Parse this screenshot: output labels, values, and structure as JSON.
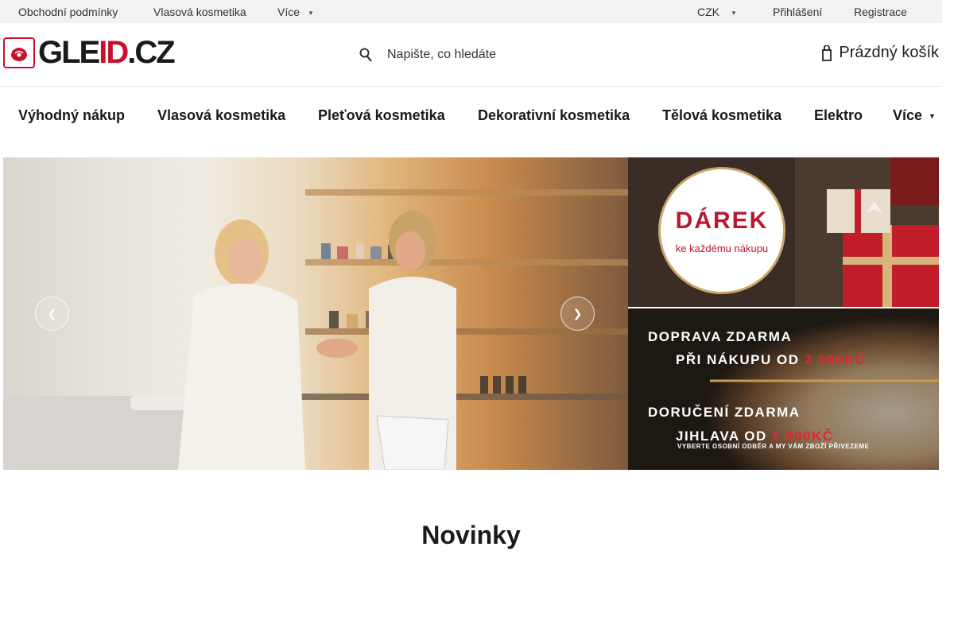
{
  "topbar": {
    "links": [
      "Obchodní podmínky",
      "Vlasová kosmetika",
      "Více"
    ],
    "currency": "CZK",
    "login": "Přihlášení",
    "register": "Registrace"
  },
  "header": {
    "logo": "GLEID.CZ",
    "search_placeholder": "Napište, co hledáte",
    "cart_label": "Prázdný košík"
  },
  "nav": {
    "items": [
      "Výhodný nákup",
      "Vlasová kosmetika",
      "Pleťová kosmetika",
      "Dekorativní kosmetika",
      "Tělová kosmetika",
      "Elektro",
      "Více"
    ]
  },
  "promo_gift": {
    "title": "DÁREK",
    "subtitle": "ke každému nákupu"
  },
  "promo_delivery": {
    "line1": "DOPRAVA ZDARMA",
    "line2_prefix": "PŘI NÁKUPU OD",
    "line2_value": "2 500KČ",
    "line3": "DORUČENÍ ZDARMA",
    "line4_prefix": "JIHLAVA OD",
    "line4_value": "1 800KČ",
    "line5": "VYBERTE OSOBNÍ ODBĚR A MY VÁM ZBOŽÍ PŘIVEZEME"
  },
  "section": {
    "title": "Novinky"
  },
  "colors": {
    "brand": "#c8102e",
    "topbar_bg": "#f2f2f2",
    "promo_red": "#e2272f"
  },
  "icons": {
    "search": "search-icon",
    "cart": "cart-icon",
    "prev": "chevron-left-icon",
    "next": "chevron-right-icon",
    "caret": "chevron-down-icon",
    "logo": "rose-icon"
  }
}
